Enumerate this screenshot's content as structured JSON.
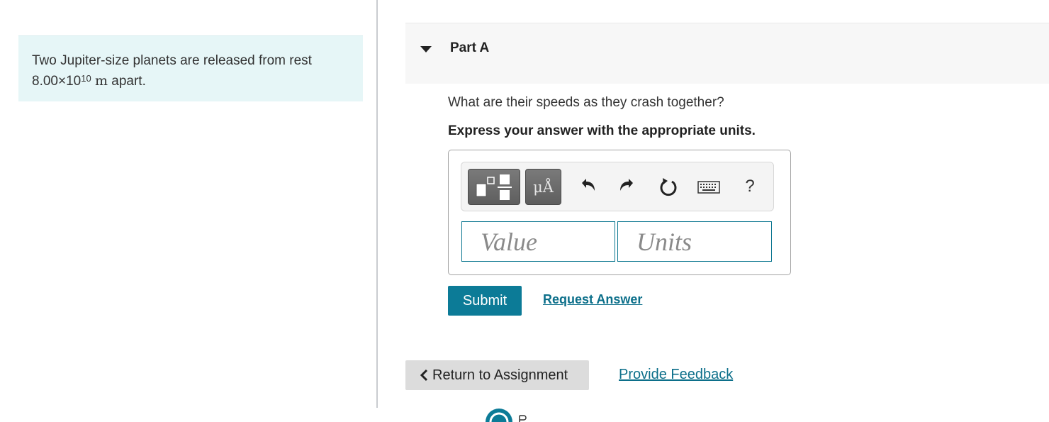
{
  "intro": {
    "text_before": "Two Jupiter-size planets are released from rest",
    "mantissa": "8.00×10",
    "exponent": "10",
    "unit": "m",
    "text_after": "apart."
  },
  "part": {
    "title": "Part A",
    "question": "What are their speeds as they crash together?",
    "instruction": "Express your answer with the appropriate units."
  },
  "toolbar": {
    "units_button_label": "μÅ",
    "help_label": "?",
    "icons": [
      "templates-icon",
      "units-icon",
      "undo-icon",
      "redo-icon",
      "reset-icon",
      "keyboard-icon",
      "help-icon"
    ]
  },
  "answer": {
    "value_placeholder": "Value",
    "units_placeholder": "Units",
    "value": "",
    "units": ""
  },
  "actions": {
    "submit_label": "Submit",
    "request_answer_label": "Request Answer",
    "return_label": "Return to Assignment",
    "feedback_label": "Provide Feedback"
  },
  "colors": {
    "accent": "#0c7b97",
    "link": "#0c6f8a",
    "intro_bg": "#e6f6f7",
    "header_bg": "#f7f7f7"
  }
}
